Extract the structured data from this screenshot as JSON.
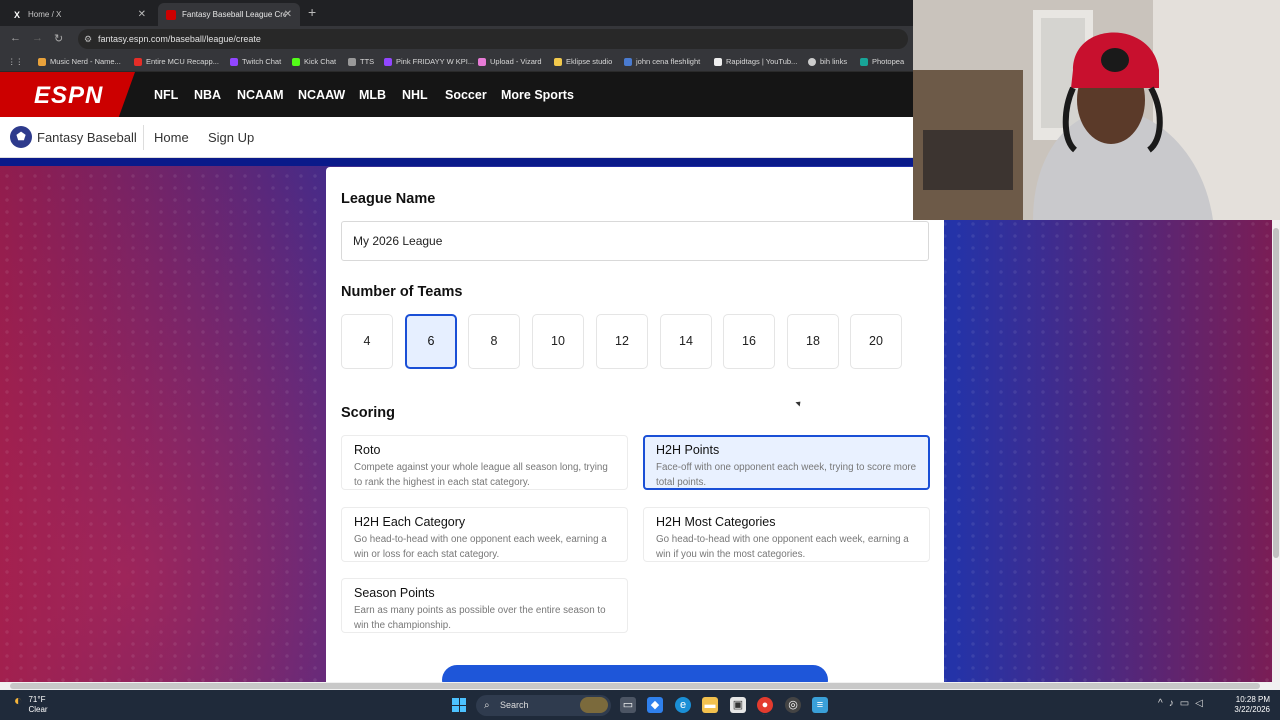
{
  "browser": {
    "tabs": [
      {
        "label": "Home / X",
        "active": false
      },
      {
        "label": "Fantasy Baseball League Creatio",
        "active": true
      }
    ],
    "url": "fantasy.espn.com/baseball/league/create",
    "bookmarks": [
      "Music Nerd - Name...",
      "Entire MCU Recapp...",
      "Twitch Chat",
      "Kick Chat",
      "TTS",
      "Pink FRIDAYY W KPI...",
      "Upload - Vizard",
      "Eklipse studio",
      "john cena fleshlight",
      "Rapidtags | YouTub...",
      "bih links",
      "Photopea"
    ]
  },
  "espn": {
    "logo": "ESPN",
    "sports": [
      "NFL",
      "NBA",
      "NCAAM",
      "NCAAW",
      "MLB",
      "NHL",
      "Soccer",
      "More Sports"
    ]
  },
  "subnav": {
    "title": "Fantasy Baseball",
    "links": [
      "Home",
      "Sign Up"
    ]
  },
  "form": {
    "league_name_label": "League Name",
    "league_name_value": "My 2026 League",
    "teams_label": "Number of Teams",
    "team_options": [
      "4",
      "6",
      "8",
      "10",
      "12",
      "14",
      "16",
      "18",
      "20"
    ],
    "team_selected": "6",
    "scoring_label": "Scoring",
    "scoring_options": [
      {
        "name": "Roto",
        "desc": "Compete against your whole league all season long, trying to rank the highest in each stat category.",
        "selected": false
      },
      {
        "name": "H2H Points",
        "desc": "Face-off with one opponent each week, trying to score more total points.",
        "selected": true
      },
      {
        "name": "H2H Each Category",
        "desc": "Go head-to-head with one opponent each week, earning a win or loss for each stat category.",
        "selected": false
      },
      {
        "name": "H2H Most Categories",
        "desc": "Go head-to-head with one opponent each week, earning a win if you win the most categories.",
        "selected": false
      },
      {
        "name": "Season Points",
        "desc": "Earn as many points as possible over the entire season to win the championship.",
        "selected": false
      }
    ]
  },
  "taskbar": {
    "weather_temp": "71°F",
    "weather_desc": "Clear",
    "search_label": "Search",
    "time": "10:28 PM",
    "date": "3/22/2026"
  },
  "colors": {
    "espn_red": "#cc0000",
    "accent_blue": "#1a4fd6"
  }
}
